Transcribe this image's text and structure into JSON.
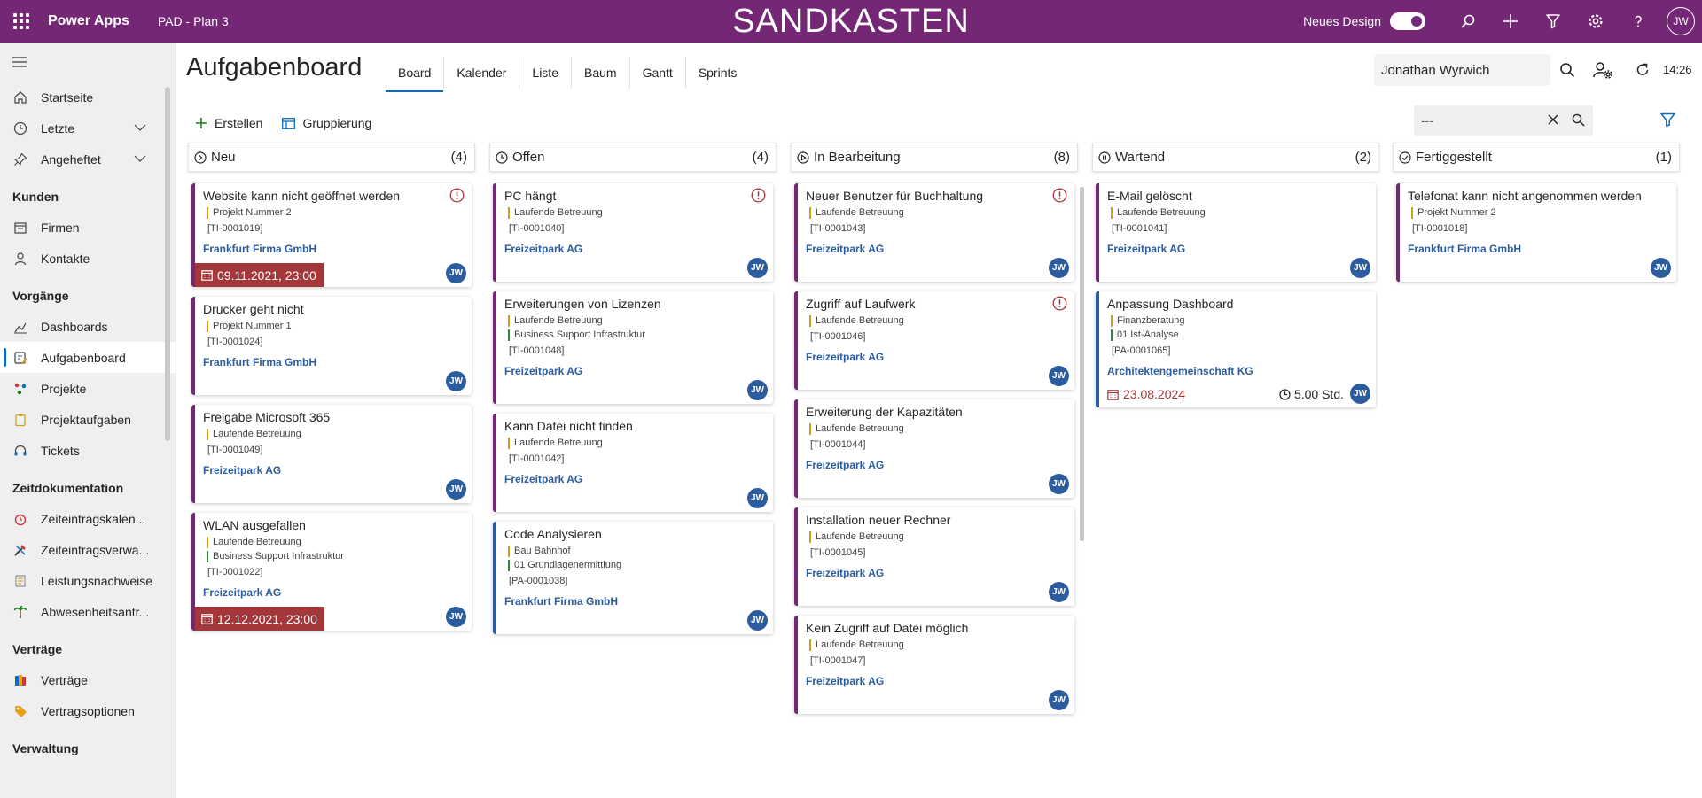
{
  "topbar": {
    "app_brand": "Power Apps",
    "app_name": "PAD - Plan 3",
    "env_title": "SANDKASTEN",
    "design_label": "Neues Design",
    "design_toggle_on": true,
    "avatar": "JW"
  },
  "sidebar": {
    "top_items": [
      {
        "label": "Startseite",
        "icon": "home-icon"
      },
      {
        "label": "Letzte",
        "icon": "clock-icon"
      },
      {
        "label": "Angeheftet",
        "icon": "pin-icon"
      }
    ],
    "sections": [
      {
        "title": "Kunden",
        "items": [
          {
            "label": "Firmen",
            "icon": "building-icon"
          },
          {
            "label": "Kontakte",
            "icon": "person-icon"
          }
        ]
      },
      {
        "title": "Vorgänge",
        "items": [
          {
            "label": "Dashboards",
            "icon": "dashboard-icon"
          },
          {
            "label": "Aufgabenboard",
            "icon": "taskboard-icon"
          },
          {
            "label": "Projekte",
            "icon": "projects-icon"
          },
          {
            "label": "Projektaufgaben",
            "icon": "clipboard-icon"
          },
          {
            "label": "Tickets",
            "icon": "headset-icon"
          }
        ]
      },
      {
        "title": "Zeitdokumentation",
        "items": [
          {
            "label": "Zeiteintragskalen...",
            "icon": "alarm-clock-icon"
          },
          {
            "label": "Zeiteintragsverwa...",
            "icon": "tools-icon"
          },
          {
            "label": "Leistungsnachweise",
            "icon": "document-list-icon"
          },
          {
            "label": "Abwesenheitsantr...",
            "icon": "palm-tree-icon"
          }
        ]
      },
      {
        "title": "Verträge",
        "items": [
          {
            "label": "Verträge",
            "icon": "contract-icon"
          },
          {
            "label": "Vertragsoptionen",
            "icon": "tag-icon"
          }
        ]
      },
      {
        "title": "Verwaltung",
        "items": []
      }
    ],
    "active": "Aufgabenboard"
  },
  "header": {
    "title": "Aufgabenboard",
    "tabs": [
      "Board",
      "Kalender",
      "Liste",
      "Baum",
      "Gantt",
      "Sprints"
    ],
    "active_tab": "Board",
    "user_value": "Jonathan Wyrwich",
    "time": "14:26"
  },
  "commands": {
    "create": "Erstellen",
    "grouping": "Gruppierung",
    "filter_value": "---"
  },
  "board": {
    "columns": [
      {
        "title": "Neu",
        "count": "(4)",
        "icon": "circle-chevron-icon",
        "cards": [
          {
            "title": "Website kann nicht geöffnet werden",
            "lines": [
              {
                "text": "Projekt Nummer 2",
                "color": "yellow"
              }
            ],
            "id": "[TI-0001019]",
            "company": "Frankfurt Firma GmbH",
            "warn": true,
            "date_badge": "09.11.2021, 23:00",
            "avatar": "JW"
          },
          {
            "title": "Drucker geht nicht",
            "lines": [
              {
                "text": "Projekt Nummer 1",
                "color": "yellow"
              }
            ],
            "id": "[TI-0001024]",
            "company": "Frankfurt Firma GmbH",
            "avatar": "JW"
          },
          {
            "title": "Freigabe Microsoft 365",
            "lines": [
              {
                "text": "Laufende Betreuung",
                "color": "yellow"
              }
            ],
            "id": "[TI-0001049]",
            "company": "Freizeitpark AG",
            "avatar": "JW"
          },
          {
            "title": "WLAN ausgefallen",
            "lines": [
              {
                "text": "Laufende Betreuung",
                "color": "yellow"
              },
              {
                "text": "Business Support Infrastruktur",
                "color": "green"
              }
            ],
            "id": "[TI-0001022]",
            "company": "Freizeitpark AG",
            "date_badge": "12.12.2021, 23:00",
            "avatar": "JW"
          }
        ]
      },
      {
        "title": "Offen",
        "count": "(4)",
        "icon": "clock-icon",
        "cards": [
          {
            "title": "PC hängt",
            "lines": [
              {
                "text": "Laufende Betreuung",
                "color": "yellow"
              }
            ],
            "id": "[TI-0001040]",
            "company": "Freizeitpark AG",
            "warn": true,
            "avatar": "JW"
          },
          {
            "title": "Erweiterungen von Lizenzen",
            "lines": [
              {
                "text": "Laufende Betreuung",
                "color": "yellow"
              },
              {
                "text": "Business Support Infrastruktur",
                "color": "green"
              }
            ],
            "id": "[TI-0001048]",
            "company": "Freizeitpark AG",
            "avatar": "JW"
          },
          {
            "title": "Kann Datei nicht finden",
            "lines": [
              {
                "text": "Laufende Betreuung",
                "color": "yellow"
              }
            ],
            "id": "[TI-0001042]",
            "company": "Freizeitpark AG",
            "avatar": "JW"
          },
          {
            "title": "Code Analysieren",
            "lines": [
              {
                "text": "Bau Bahnhof",
                "color": "yellow"
              },
              {
                "text": "01 Grundlagenermittlung",
                "color": "green"
              }
            ],
            "id": "[PA-0001038]",
            "company": "Frankfurt Firma GmbH",
            "avatar": "JW",
            "blue": true
          }
        ]
      },
      {
        "title": "In Bearbeitung",
        "count": "(8)",
        "icon": "play-circle-icon",
        "cards": [
          {
            "title": "Neuer Benutzer für Buchhaltung",
            "lines": [
              {
                "text": "Laufende Betreuung",
                "color": "yellow"
              }
            ],
            "id": "[TI-0001043]",
            "company": "Freizeitpark AG",
            "warn": true,
            "avatar": "JW"
          },
          {
            "title": "Zugriff auf Laufwerk",
            "lines": [
              {
                "text": "Laufende Betreuung",
                "color": "yellow"
              }
            ],
            "id": "[TI-0001046]",
            "company": "Freizeitpark AG",
            "warn": true,
            "avatar": "JW"
          },
          {
            "title": "Erweiterung der Kapazitäten",
            "lines": [
              {
                "text": "Laufende Betreuung",
                "color": "yellow"
              }
            ],
            "id": "[TI-0001044]",
            "company": "Freizeitpark AG",
            "avatar": "JW"
          },
          {
            "title": "Installation neuer Rechner",
            "lines": [
              {
                "text": "Laufende Betreuung",
                "color": "yellow"
              }
            ],
            "id": "[TI-0001045]",
            "company": "Freizeitpark AG",
            "avatar": "JW"
          },
          {
            "title": "Kein Zugriff auf Datei möglich",
            "lines": [
              {
                "text": "Laufende Betreuung",
                "color": "yellow"
              }
            ],
            "id": "[TI-0001047]",
            "company": "Freizeitpark AG",
            "avatar": "JW"
          }
        ]
      },
      {
        "title": "Wartend",
        "count": "(2)",
        "icon": "pause-circle-icon",
        "cards": [
          {
            "title": "E-Mail gelöscht",
            "lines": [
              {
                "text": "Laufende Betreuung",
                "color": "yellow"
              }
            ],
            "id": "[TI-0001041]",
            "company": "Freizeitpark AG",
            "avatar": "JW"
          },
          {
            "title": "Anpassung Dashboard",
            "lines": [
              {
                "text": "Finanzberatung",
                "color": "yellow"
              },
              {
                "text": "01 Ist-Analyse",
                "color": "green"
              }
            ],
            "id": "[PA-0001065]",
            "company": "Architektengemeinschaft KG",
            "date_plain": "23.08.2024",
            "hours": "5.00 Std.",
            "avatar": "JW",
            "blue": true
          }
        ]
      },
      {
        "title": "Fertiggestellt",
        "count": "(1)",
        "icon": "check-circle-icon",
        "cards": [
          {
            "title": "Telefonat kann nicht angenommen werden",
            "lines": [
              {
                "text": "Projekt Nummer 2",
                "color": "yellow"
              }
            ],
            "id": "[TI-0001018]",
            "company": "Frankfurt Firma GmbH",
            "avatar": "JW"
          }
        ]
      }
    ]
  },
  "colors": {
    "brand": "#742774",
    "accent": "#0f6cbd",
    "link": "#2b5c9e",
    "danger": "#a4373a"
  }
}
